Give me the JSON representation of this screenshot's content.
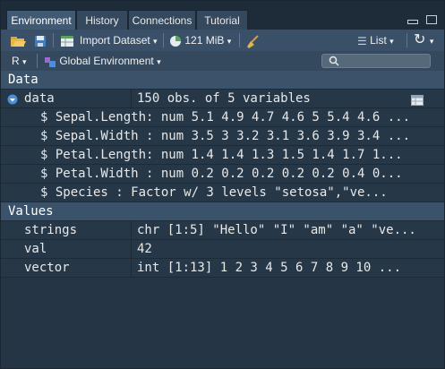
{
  "tabs": [
    {
      "label": "Environment",
      "active": true
    },
    {
      "label": "History",
      "active": false
    },
    {
      "label": "Connections",
      "active": false
    },
    {
      "label": "Tutorial",
      "active": false
    }
  ],
  "toolbar": {
    "import_label": "Import Dataset",
    "memory_label": "121 MiB",
    "view_label": "List"
  },
  "toolbar2": {
    "language_label": "R",
    "env_label": "Global Environment",
    "search_placeholder": ""
  },
  "data_section": {
    "title": "Data",
    "name": "data",
    "value": "150 obs. of 5 variables",
    "fields": [
      "$ Sepal.Length: num  5.1 4.9 4.7 4.6 5 5.4 4.6 ...",
      "$ Sepal.Width : num  3.5 3 3.2 3.1 3.6 3.9 3.4 ...",
      "$ Petal.Length: num  1.4 1.4 1.3 1.5 1.4 1.7 1...",
      "$ Petal.Width : num  0.2 0.2 0.2 0.2 0.2 0.4 0...",
      "$ Species     : Factor w/ 3 levels \"setosa\",\"ve..."
    ]
  },
  "values_section": {
    "title": "Values",
    "rows": [
      {
        "name": "strings",
        "value": "chr [1:5] \"Hello\" \"I\" \"am\" \"a\" \"ve..."
      },
      {
        "name": "val",
        "value": "42"
      },
      {
        "name": "vector",
        "value": "int [1:13] 1 2 3 4 5 6 7 8 9 10 ..."
      }
    ]
  },
  "colors": {
    "background": "#2b3e50",
    "section": "#3a536b",
    "row": "#263848",
    "accent_blue": "#4a8fd8"
  }
}
